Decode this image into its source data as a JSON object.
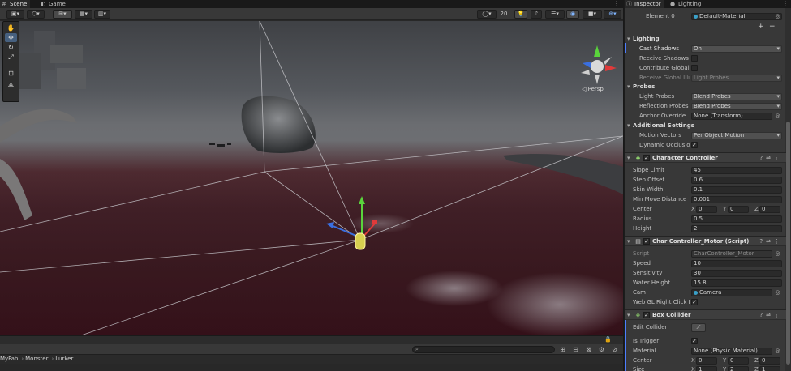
{
  "scene_tabs": {
    "scene": "Scene",
    "game": "Game"
  },
  "scene_toolbar": {
    "grid_size": "20"
  },
  "viewport": {
    "persp_label": "Persp"
  },
  "breadcrumb": {
    "items": [
      "MyFab",
      "Monster",
      "Lurker"
    ]
  },
  "inspector_tabs": {
    "inspector": "Inspector",
    "lighting": "Lighting"
  },
  "mesh_renderer": {
    "element_label": "Element 0",
    "element_value": "Default-Material",
    "lighting": {
      "title": "Lighting",
      "cast_shadows_label": "Cast Shadows",
      "cast_shadows_value": "On",
      "receive_shadows_label": "Receive Shadows",
      "contribute_gi_label": "Contribute Global I",
      "receive_gi_label": "Receive Global Illu",
      "receive_gi_value": "Light Probes"
    },
    "probes": {
      "title": "Probes",
      "light_probes_label": "Light Probes",
      "light_probes_value": "Blend Probes",
      "reflection_probes_label": "Reflection Probes",
      "reflection_probes_value": "Blend Probes",
      "anchor_override_label": "Anchor Override",
      "anchor_override_value": "None (Transform)"
    },
    "additional": {
      "title": "Additional Settings",
      "motion_vectors_label": "Motion Vectors",
      "motion_vectors_value": "Per Object Motion",
      "dynamic_occlusion_label": "Dynamic Occlusio"
    }
  },
  "character_controller": {
    "title": "Character Controller",
    "slope_limit_label": "Slope Limit",
    "slope_limit": "45",
    "step_offset_label": "Step Offset",
    "step_offset": "0.6",
    "skin_width_label": "Skin Width",
    "skin_width": "0.1",
    "min_move_label": "Min Move Distance",
    "min_move": "0.001",
    "center_label": "Center",
    "center": {
      "x": "0",
      "y": "0",
      "z": "0"
    },
    "radius_label": "Radius",
    "radius": "0.5",
    "height_label": "Height",
    "height": "2"
  },
  "motor_script": {
    "title": "Char Controller_Motor (Script)",
    "script_label": "Script",
    "script_value": "CharController_Motor",
    "speed_label": "Speed",
    "speed": "10",
    "sensitivity_label": "Sensitivity",
    "sensitivity": "30",
    "water_height_label": "Water Height",
    "water_height": "15.8",
    "cam_label": "Cam",
    "cam_value": "Camera",
    "webgl_label": "Web GL Right Click R"
  },
  "box_collider": {
    "title": "Box Collider",
    "edit_collider_label": "Edit Collider",
    "is_trigger_label": "Is Trigger",
    "material_label": "Material",
    "material_value": "None (Physic Material)",
    "center_label": "Center",
    "center": {
      "x": "0",
      "y": "0",
      "z": "0"
    },
    "size_label": "Size",
    "size": {
      "x": "1",
      "y": "2",
      "z": "1"
    }
  },
  "axis_letters": {
    "x": "X",
    "y": "Y",
    "z": "Z"
  },
  "colors": {
    "selection_blue": "#4c7dff",
    "gizmo_x": "#e03a3a",
    "gizmo_y": "#5ad43c",
    "gizmo_z": "#3a6fe0"
  }
}
